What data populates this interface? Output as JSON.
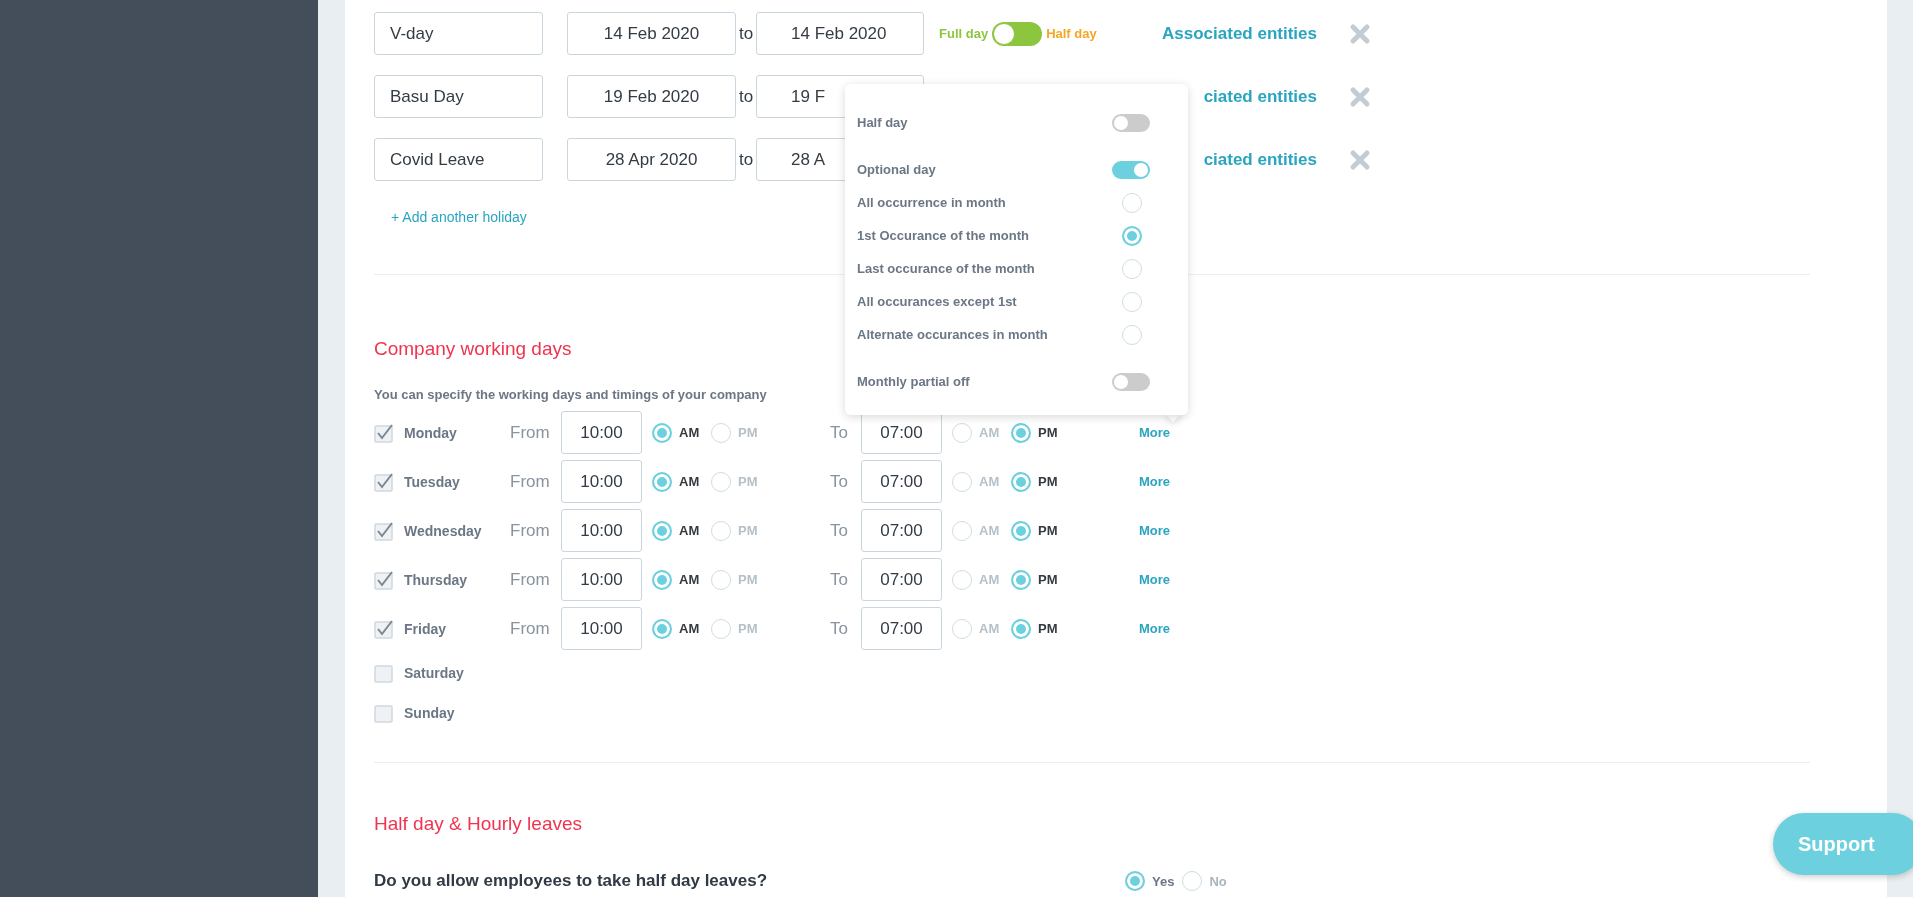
{
  "holidays": [
    {
      "name": "V-day",
      "from": "14 Feb 2020",
      "to_label": "to",
      "to": "14 Feb 2020",
      "day_type": {
        "full_label": "Full day",
        "half_label": "Half day",
        "half_day": false
      },
      "link": "Associated entities"
    },
    {
      "name": "Basu Day",
      "from": "19 Feb 2020",
      "to_label": "to",
      "to": "19 F",
      "link": "ciated entities"
    },
    {
      "name": "Covid Leave",
      "from": "28 Apr 2020",
      "to_label": "to",
      "to": "28 A",
      "link": "ciated entities"
    }
  ],
  "add_holiday": "+ Add another holiday",
  "working_days": {
    "title": "Company working days",
    "description": "You can specify the working days and timings of your company",
    "days": [
      {
        "name": "Monday",
        "checked": true,
        "from_label": "From",
        "from": "10:00",
        "from_period": [
          {
            "label": "AM",
            "selected": true
          },
          {
            "label": "PM",
            "selected": false
          }
        ],
        "to_label": "To",
        "to": "07:00",
        "to_period": [
          {
            "label": "AM",
            "selected": false
          },
          {
            "label": "PM",
            "selected": true
          }
        ],
        "more": "More"
      },
      {
        "name": "Tuesday",
        "checked": true,
        "from_label": "From",
        "from": "10:00",
        "from_period": [
          {
            "label": "AM",
            "selected": true
          },
          {
            "label": "PM",
            "selected": false
          }
        ],
        "to_label": "To",
        "to": "07:00",
        "to_period": [
          {
            "label": "AM",
            "selected": false
          },
          {
            "label": "PM",
            "selected": true
          }
        ],
        "more": "More"
      },
      {
        "name": "Wednesday",
        "checked": true,
        "from_label": "From",
        "from": "10:00",
        "from_period": [
          {
            "label": "AM",
            "selected": true
          },
          {
            "label": "PM",
            "selected": false
          }
        ],
        "to_label": "To",
        "to": "07:00",
        "to_period": [
          {
            "label": "AM",
            "selected": false
          },
          {
            "label": "PM",
            "selected": true
          }
        ],
        "more": "More"
      },
      {
        "name": "Thursday",
        "checked": true,
        "from_label": "From",
        "from": "10:00",
        "from_period": [
          {
            "label": "AM",
            "selected": true
          },
          {
            "label": "PM",
            "selected": false
          }
        ],
        "to_label": "To",
        "to": "07:00",
        "to_period": [
          {
            "label": "AM",
            "selected": false
          },
          {
            "label": "PM",
            "selected": true
          }
        ],
        "more": "More"
      },
      {
        "name": "Friday",
        "checked": true,
        "from_label": "From",
        "from": "10:00",
        "from_period": [
          {
            "label": "AM",
            "selected": true
          },
          {
            "label": "PM",
            "selected": false
          }
        ],
        "to_label": "To",
        "to": "07:00",
        "to_period": [
          {
            "label": "AM",
            "selected": false
          },
          {
            "label": "PM",
            "selected": true
          }
        ],
        "more": "More"
      },
      {
        "name": "Saturday",
        "checked": false
      },
      {
        "name": "Sunday",
        "checked": false
      }
    ]
  },
  "popup": {
    "items": [
      {
        "kind": "toggle",
        "label": "Half day",
        "on": false
      },
      {
        "kind": "toggle",
        "label": "Optional day",
        "on": true
      },
      {
        "kind": "radio",
        "label": "All occurrence in month",
        "selected": false
      },
      {
        "kind": "radio",
        "label": "1st Occurance of the month",
        "selected": true
      },
      {
        "kind": "radio",
        "label": "Last occurance of the month",
        "selected": false
      },
      {
        "kind": "radio",
        "label": "All occurances except 1st",
        "selected": false
      },
      {
        "kind": "radio",
        "label": "Alternate occurances in month",
        "selected": false
      },
      {
        "kind": "toggle",
        "label": "Monthly partial off",
        "on": false
      }
    ]
  },
  "half_day_section": {
    "title": "Half day & Hourly leaves",
    "question": "Do you allow employees to take half day leaves?",
    "options": [
      {
        "label": "Yes",
        "selected": true
      },
      {
        "label": "No",
        "selected": false
      }
    ]
  },
  "support_button": "Support"
}
